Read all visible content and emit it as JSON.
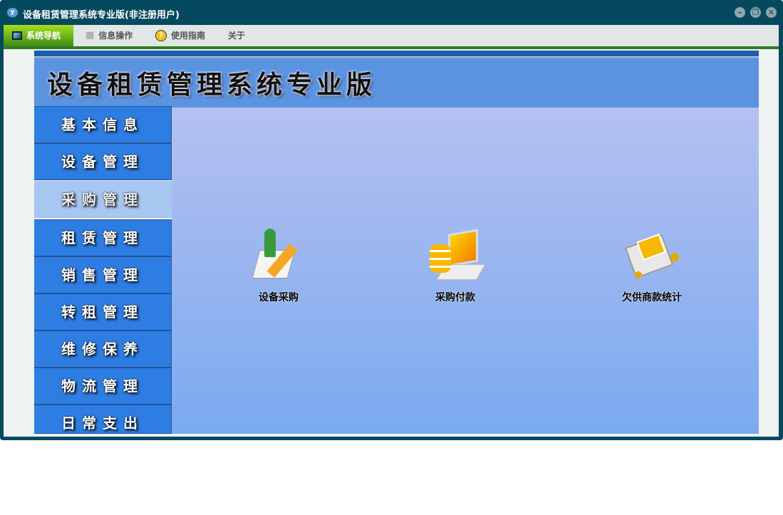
{
  "window": {
    "title": "设备租赁管理系统专业版(非注册用户)",
    "controls": [
      "minimize",
      "restore",
      "close"
    ]
  },
  "menu": [
    {
      "label": "系统导航",
      "icon": "monitor-icon",
      "active": true
    },
    {
      "label": "信息操作",
      "icon": "grid-icon"
    },
    {
      "label": "使用指南",
      "icon": "help-icon"
    },
    {
      "label": "关于"
    }
  ],
  "header": {
    "title": "设备租赁管理系统专业版"
  },
  "sidebar": [
    {
      "label": "基本信息"
    },
    {
      "label": "设备管理"
    },
    {
      "label": "采购管理",
      "selected": true
    },
    {
      "label": "租赁管理"
    },
    {
      "label": "销售管理"
    },
    {
      "label": "转租管理"
    },
    {
      "label": "维修保养"
    },
    {
      "label": "物流管理"
    },
    {
      "label": "日常支出"
    }
  ],
  "functions": [
    {
      "label": "设备采购",
      "icon": "purchase-icon"
    },
    {
      "label": "采购付款",
      "icon": "payment-icon"
    },
    {
      "label": "欠供商款统计",
      "icon": "supplier-debt-icon"
    }
  ]
}
